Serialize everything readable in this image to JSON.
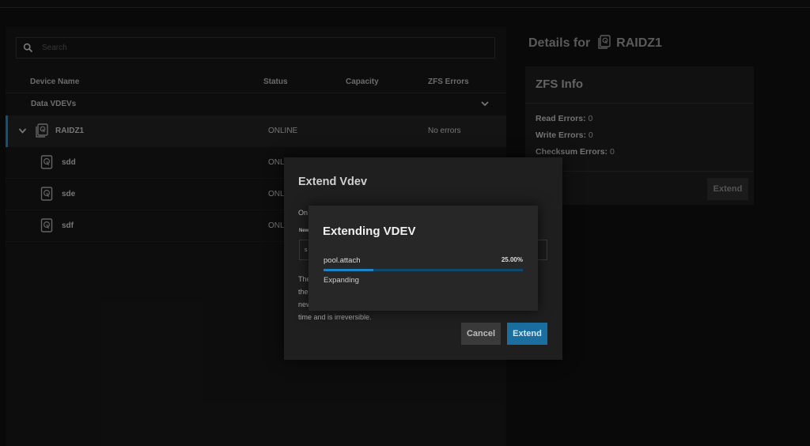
{
  "search": {
    "placeholder": "Search"
  },
  "table": {
    "headers": [
      "Device Name",
      "Status",
      "Capacity",
      "ZFS Errors"
    ],
    "group_label": "Data VDEVs",
    "rows": [
      {
        "name": "RAIDZ1",
        "status": "ONLINE",
        "errors": "No errors",
        "icon": "raid-disk-icon"
      },
      {
        "name": "sdd",
        "status": "ONLI",
        "icon": "disk-icon"
      },
      {
        "name": "sde",
        "status": "ONL",
        "icon": "disk-icon"
      },
      {
        "name": "sdf",
        "status": "ONL",
        "icon": "disk-icon"
      }
    ]
  },
  "details": {
    "prefix": "Details for",
    "device": "RAIDZ1",
    "zfs_info": {
      "title": "ZFS Info",
      "read_label": "Read Errors:",
      "read_value": "0",
      "write_label": "Write Errors:",
      "write_value": "0",
      "checksum_label": "Checksum Errors:",
      "checksum_value": "0"
    },
    "extend_label": "Extend"
  },
  "extend_dialog": {
    "title": "Extend Vdev",
    "intro": "On",
    "field_label": "New",
    "field_value": "s",
    "warn_lines": [
      "The",
      "the",
      "new",
      "time and is irreversible."
    ],
    "cancel_label": "Cancel",
    "extend_label": "Extend"
  },
  "job_dialog": {
    "title": "Extending VDEV",
    "task": "pool.attach",
    "progress_label": "25.00%",
    "progress_fraction": 0.25,
    "description": "Expanding"
  },
  "colors": {
    "accent": "#1a84c4",
    "primary_button": "#1a6fa0"
  }
}
